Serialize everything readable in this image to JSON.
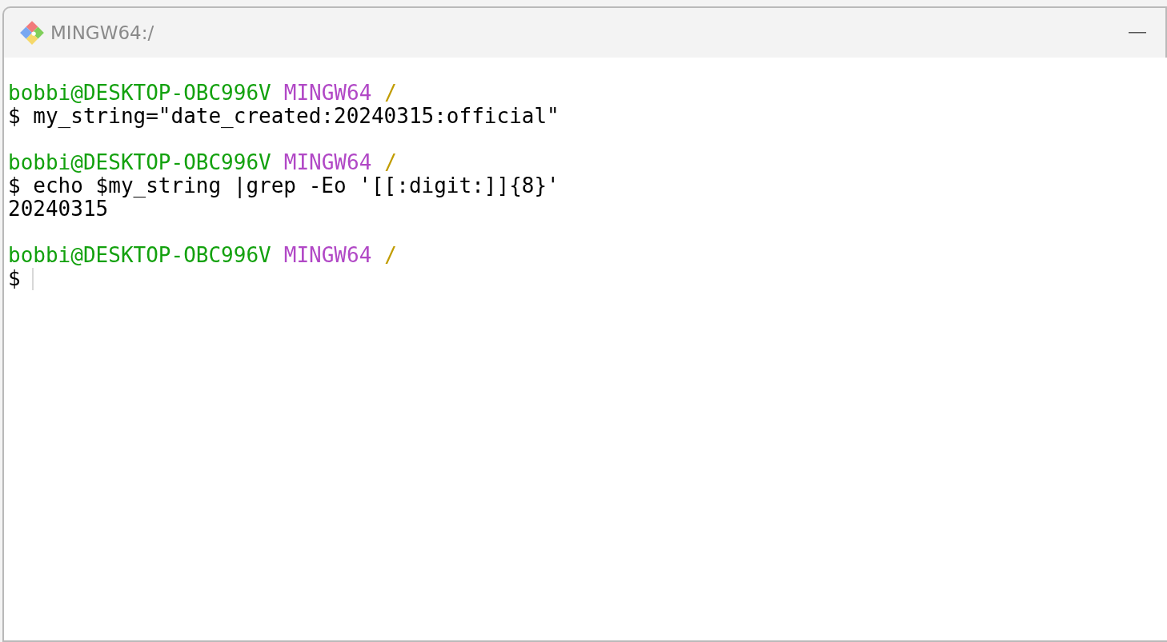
{
  "window": {
    "title": "MINGW64:/"
  },
  "terminal": {
    "blocks": [
      {
        "prompt": {
          "user": "bobbi@DESKTOP-OBC996V",
          "system": "MINGW64",
          "path": "/"
        },
        "lines": [
          {
            "kind": "command",
            "text": "$ my_string=\"date_created:20240315:official\""
          }
        ]
      },
      {
        "prompt": {
          "user": "bobbi@DESKTOP-OBC996V",
          "system": "MINGW64",
          "path": "/"
        },
        "lines": [
          {
            "kind": "command",
            "text": "$ echo $my_string |grep -Eo '[[:digit:]]{8}'"
          },
          {
            "kind": "output",
            "text": "20240315"
          }
        ]
      },
      {
        "prompt": {
          "user": "bobbi@DESKTOP-OBC996V",
          "system": "MINGW64",
          "path": "/"
        },
        "lines": [
          {
            "kind": "input",
            "text": "$",
            "cursor": true
          }
        ]
      }
    ]
  }
}
